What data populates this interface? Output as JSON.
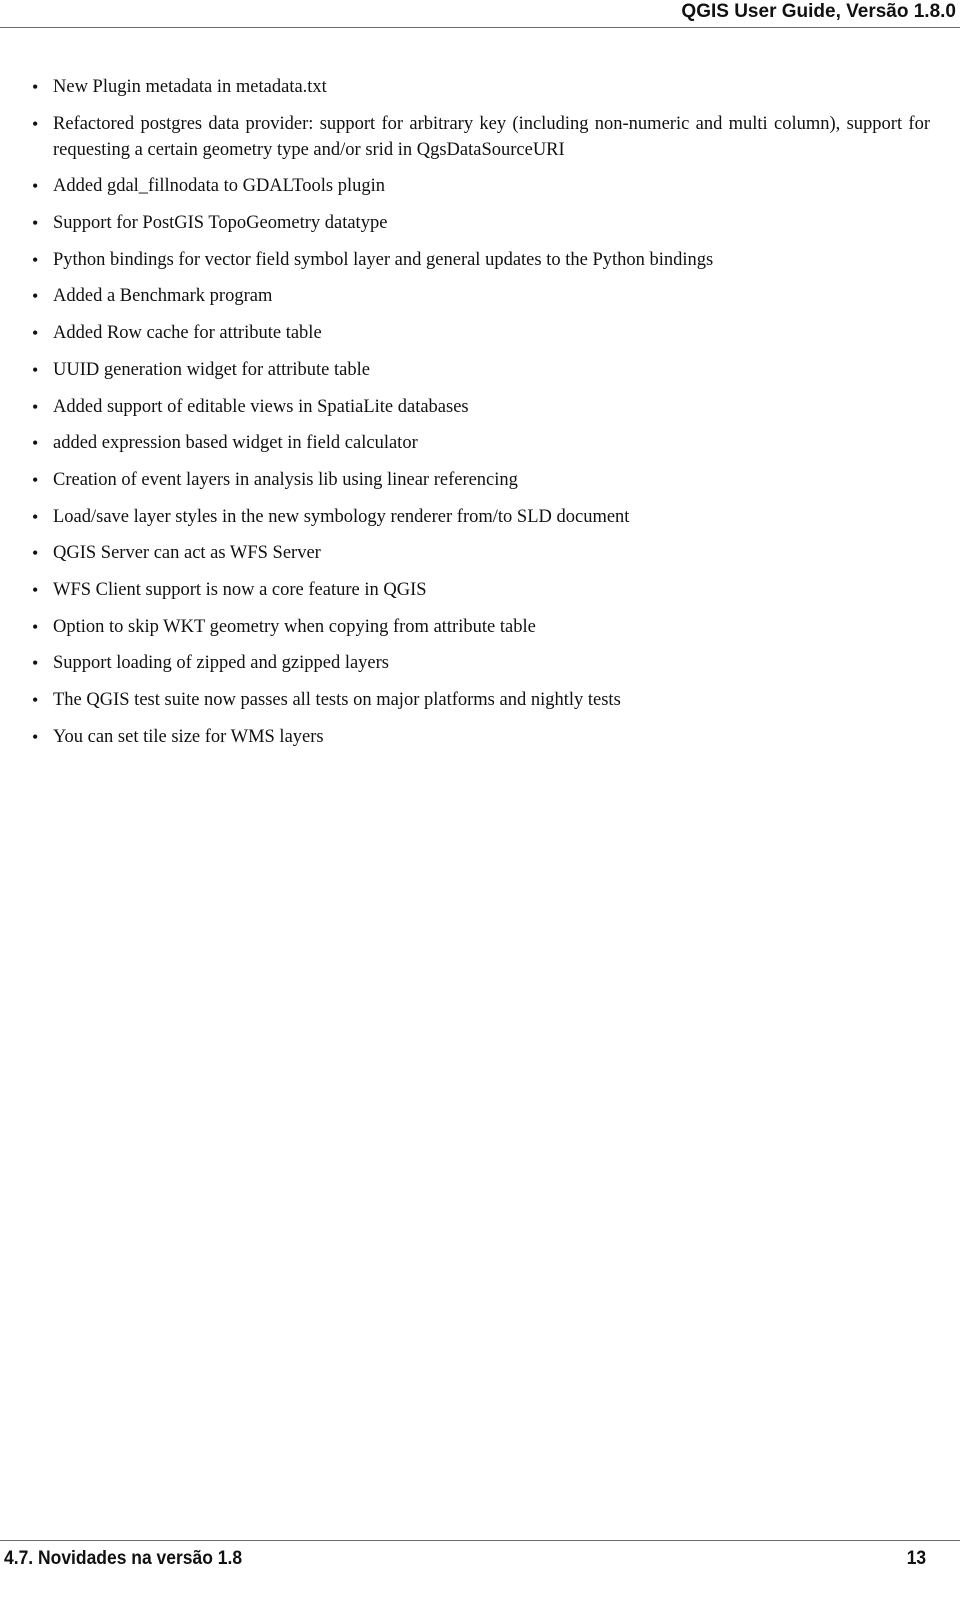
{
  "header": {
    "title": "QGIS User Guide, Versão 1.8.0"
  },
  "features": {
    "items": [
      "New Plugin metadata in metadata.txt",
      "Refactored postgres data provider: support for arbitrary key (including non-numeric and multi column), support for requesting a certain geometry type and/or srid in QgsDataSourceURI",
      "Added gdal_fillnodata to GDALTools plugin",
      "Support for PostGIS TopoGeometry datatype",
      "Python bindings for vector field symbol layer and general updates to the Python bindings",
      "Added a Benchmark program",
      "Added Row cache for attribute table",
      "UUID generation widget for attribute table",
      "Added support of editable views in SpatiaLite databases",
      "added expression based widget in field calculator",
      "Creation of event layers in analysis lib using linear referencing",
      "Load/save layer styles in the new symbology renderer from/to SLD document",
      "QGIS Server can act as WFS Server",
      "WFS Client support is now a core feature in QGIS",
      "Option to skip WKT geometry when copying from attribute table",
      "Support loading of zipped and gzipped layers",
      "The QGIS test suite now passes all tests on major platforms and nightly tests",
      "You can set tile size for WMS layers"
    ],
    "bullet": "•"
  },
  "footer": {
    "section": "4.7.  Novidades na versão 1.8",
    "page_number": "13"
  }
}
